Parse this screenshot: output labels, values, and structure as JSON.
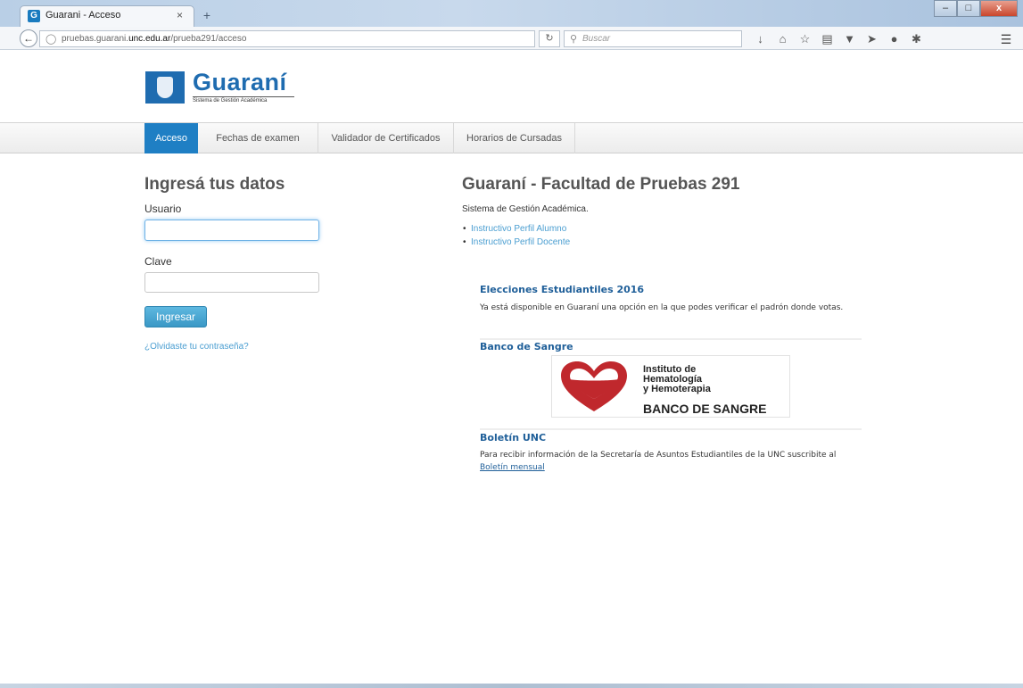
{
  "browser": {
    "tab_title": "Guarani - Acceso",
    "tab_favicon_letter": "G",
    "tab_close": "×",
    "new_tab": "+",
    "url_prefix": "pruebas.guarani.",
    "url_domain": "unc.edu.ar",
    "url_path": "/prueba291/acceso",
    "search_placeholder": "Buscar",
    "minimize": "–",
    "maximize": "□",
    "close": "x"
  },
  "header": {
    "logo_title": "Guaraní",
    "logo_subtitle": "Sistema de Gestión Académica"
  },
  "menu": {
    "items": [
      {
        "label": "Acceso",
        "active": true
      },
      {
        "label": "Fechas de examen",
        "active": false
      },
      {
        "label": "Validador de Certificados",
        "active": false
      },
      {
        "label": "Horarios de Cursadas",
        "active": false
      }
    ]
  },
  "login": {
    "heading": "Ingresá tus datos",
    "usuario_label": "Usuario",
    "usuario_value": "",
    "clave_label": "Clave",
    "submit_label": "Ingresar",
    "forgot_label": "¿Olvidaste tu contraseña?"
  },
  "info": {
    "heading": "Guaraní - Facultad de Pruebas 291",
    "subtitle": "Sistema de Gestión Académica.",
    "links": [
      "Instructivo Perfil Alumno",
      "Instructivo Perfil Docente"
    ]
  },
  "news": [
    {
      "title": "Elecciones Estudiantiles 2016",
      "body": "Ya está disponible en Guaraní una opción en la que podes verificar el padrón donde votas."
    },
    {
      "title": "Banco de Sangre"
    },
    {
      "title": "Boletín UNC",
      "body_prefix": "Para recibir información de la Secretaría de Asuntos Estudiantiles de la UNC suscribite al ",
      "link": "Boletín mensual"
    }
  ],
  "blood_banner": {
    "line1": "Instituto de",
    "line2": "Hematología",
    "line3": "y Hemoterapia",
    "line4": "BANCO DE SANGRE"
  },
  "colors": {
    "accent": "#1f7fc4",
    "link": "#4a9ed1",
    "news_title": "#1f5f99",
    "heart_red": "#c0282d"
  }
}
